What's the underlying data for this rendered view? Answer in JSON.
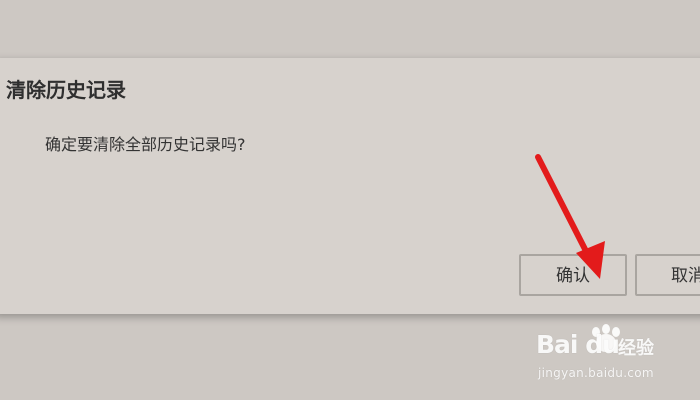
{
  "dialog": {
    "title": "清除历史记录",
    "message": "确定要清除全部历史记录吗?",
    "confirm_label": "确认",
    "cancel_label": "取消"
  },
  "annotation": {
    "color": "#e31b1b"
  },
  "watermark": {
    "brand": "Bai du",
    "product": "经验",
    "url": "jingyan.baidu.com"
  },
  "colors": {
    "background": "#cdc8c3",
    "dialog": "#d7d2cd",
    "button_border": "#a9a5a0",
    "text": "#333333"
  }
}
